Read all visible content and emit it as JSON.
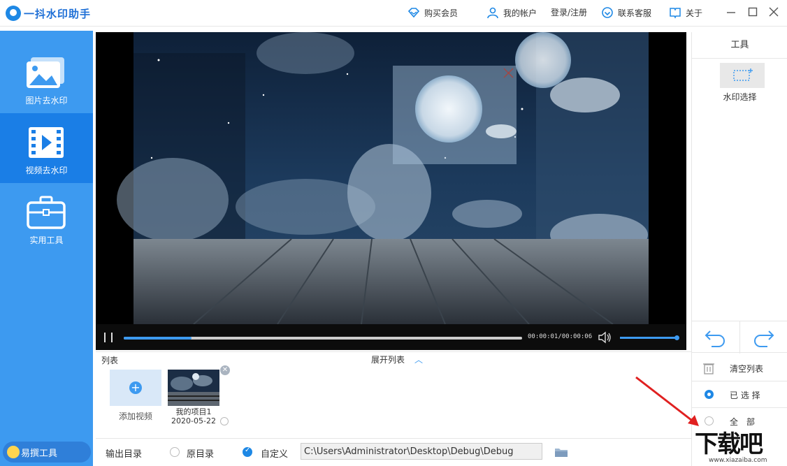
{
  "app": {
    "title": "一抖水印助手"
  },
  "header": {
    "buy_vip": "购买会员",
    "my_account": "我的帐户",
    "login_register": "登录/注册",
    "contact_service": "联系客服",
    "about": "关于"
  },
  "sidebar": {
    "items": [
      {
        "label": "图片去水印",
        "icon": "image-icon"
      },
      {
        "label": "视频去水印",
        "icon": "video-icon"
      },
      {
        "label": "实用工具",
        "icon": "toolbox-icon"
      }
    ],
    "promo": "易撰工具"
  },
  "player": {
    "time": "00:00:01/00:00:06",
    "progress": 0.17,
    "volume": 1.0
  },
  "list": {
    "label": "列表",
    "expand": "展开列表",
    "add_video": "添加视频",
    "items": [
      {
        "name": "我的项目1",
        "date": "2020-05-22"
      }
    ]
  },
  "output": {
    "label": "输出目录",
    "original": "原目录",
    "custom": "自定义",
    "path": "C:\\Users\\Administrator\\Desktop\\Debug\\Debug"
  },
  "tools": {
    "title": "工具",
    "watermark_select": "水印选择",
    "clear_list": "清空列表",
    "selected": "已 选 择",
    "all": "全　部"
  },
  "badge": {
    "logo_text": "下载吧",
    "url": "www.xiazaiba.com"
  },
  "colors": {
    "accent": "#3d9af0",
    "sidebar_active": "#1a7ee6"
  }
}
